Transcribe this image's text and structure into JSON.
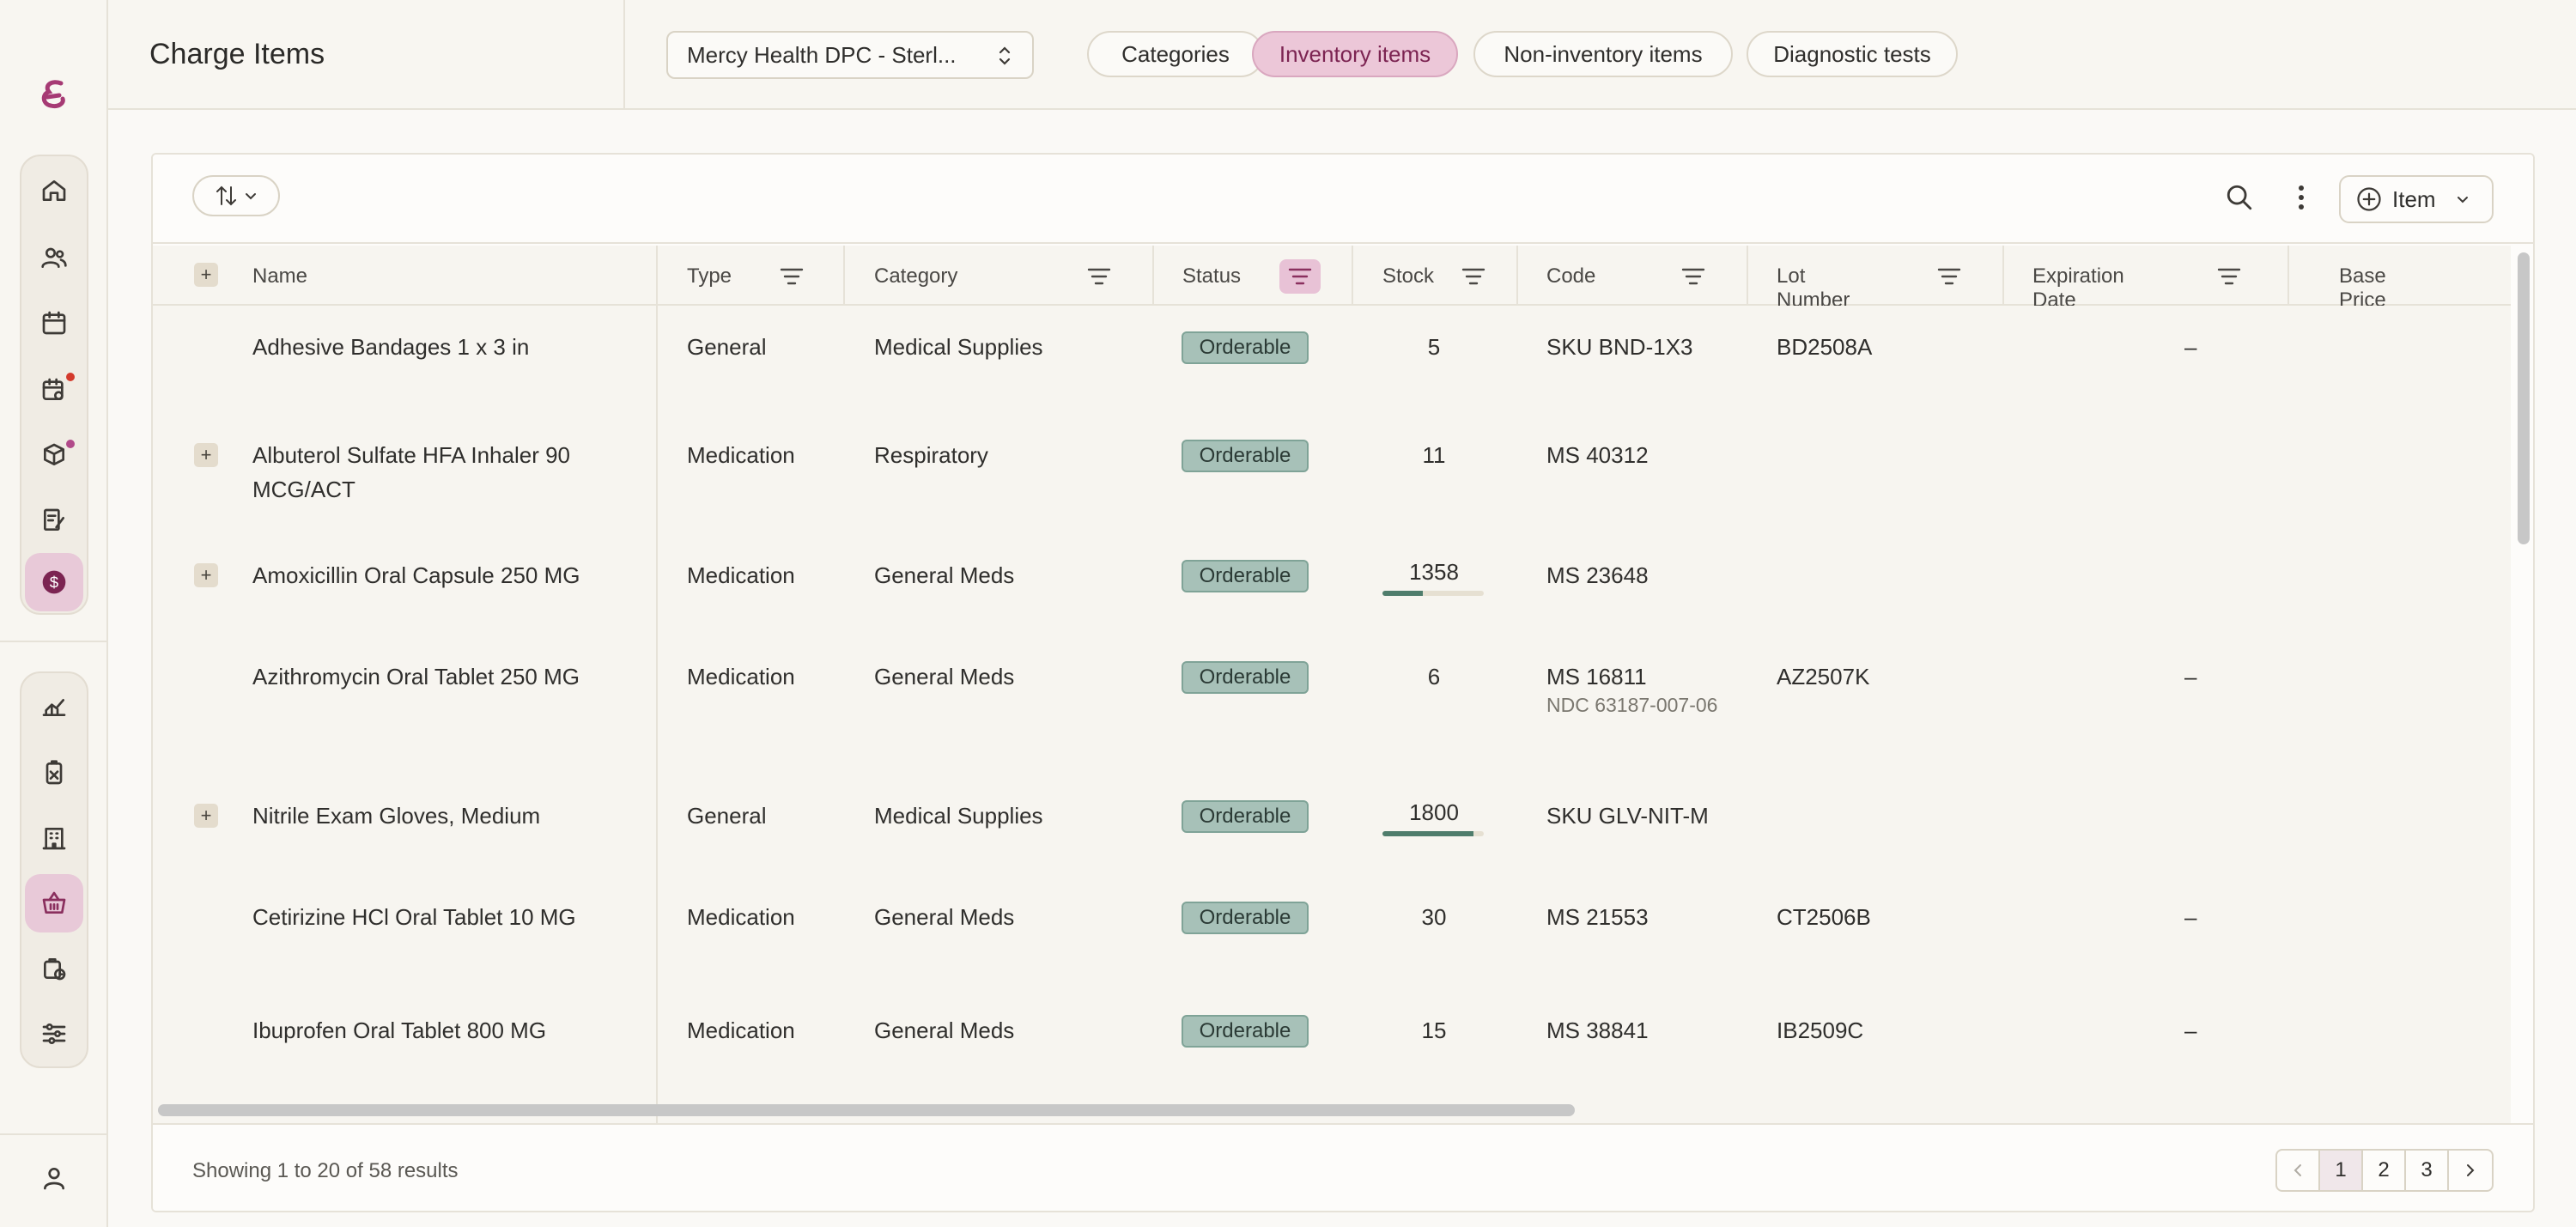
{
  "header": {
    "title": "Charge Items",
    "location": "Mercy Health DPC - Sterl...",
    "tabs": [
      {
        "label": "Categories",
        "active": false
      },
      {
        "label": "Inventory items",
        "active": true
      },
      {
        "label": "Non-inventory items",
        "active": false
      },
      {
        "label": "Diagnostic tests",
        "active": false
      }
    ]
  },
  "sidebar": {
    "top_items": [
      "home-icon",
      "patients-icon",
      "calendar-icon",
      "schedule-alert-icon",
      "inventory-icon",
      "checklist-icon",
      "billing-icon"
    ],
    "bottom_items": [
      "analytics-icon",
      "badge-icon",
      "building-icon",
      "basket-icon",
      "orders-icon",
      "settings-sliders-icon"
    ],
    "active_top": "billing-icon",
    "active_bottom": "basket-icon"
  },
  "toolbar": {
    "add_item_label": "Item"
  },
  "table": {
    "columns": [
      "Name",
      "Type",
      "Category",
      "Status",
      "Stock",
      "Code",
      "Lot Number",
      "Expiration Date",
      "Base Price Per Ur"
    ],
    "rows": [
      {
        "name": "Adhesive Bandages 1 x 3 in",
        "type": "General",
        "category": "Medical Supplies",
        "status": "Orderable",
        "stock": "5",
        "code": "SKU BND-1X3",
        "code_sub": "",
        "lot": "BD2508A",
        "expiration": "–",
        "expandable": false,
        "stock_level": null
      },
      {
        "name": "Albuterol Sulfate HFA Inhaler 90 MCG/ACT",
        "type": "Medication",
        "category": "Respiratory",
        "status": "Orderable",
        "stock": "11",
        "code": "MS 40312",
        "code_sub": "",
        "lot": "",
        "expiration": "",
        "expandable": true,
        "stock_level": null
      },
      {
        "name": "Amoxicillin Oral Capsule 250 MG",
        "type": "Medication",
        "category": "General Meds",
        "status": "Orderable",
        "stock": "1358",
        "code": "MS 23648",
        "code_sub": "",
        "lot": "",
        "expiration": "",
        "expandable": true,
        "stock_level": 0.4
      },
      {
        "name": "Azithromycin Oral Tablet 250 MG",
        "type": "Medication",
        "category": "General Meds",
        "status": "Orderable",
        "stock": "6",
        "code": "MS 16811",
        "code_sub": "NDC 63187-007-06",
        "lot": "AZ2507K",
        "expiration": "–",
        "expandable": false,
        "stock_level": null
      },
      {
        "name": "Nitrile Exam Gloves, Medium",
        "type": "General",
        "category": "Medical Supplies",
        "status": "Orderable",
        "stock": "1800",
        "code": "SKU GLV-NIT-M",
        "code_sub": "",
        "lot": "",
        "expiration": "",
        "expandable": true,
        "stock_level": 0.9
      },
      {
        "name": "Cetirizine HCl Oral Tablet 10 MG",
        "type": "Medication",
        "category": "General Meds",
        "status": "Orderable",
        "stock": "30",
        "code": "MS 21553",
        "code_sub": "",
        "lot": "CT2506B",
        "expiration": "–",
        "expandable": false,
        "stock_level": null
      },
      {
        "name": "Ibuprofen Oral Tablet 800 MG",
        "type": "Medication",
        "category": "General Meds",
        "status": "Orderable",
        "stock": "15",
        "code": "MS 38841",
        "code_sub": "",
        "lot": "IB2509C",
        "expiration": "–",
        "expandable": false,
        "stock_level": null
      }
    ]
  },
  "footer": {
    "showing": "Showing 1 to 20 of 58 results",
    "pages": [
      "1",
      "2",
      "3"
    ],
    "current_page": "1"
  },
  "colors": {
    "accent": "#8a2f5e",
    "badge": "#a7c1b8",
    "stock_bar": "#4f7d6c"
  }
}
